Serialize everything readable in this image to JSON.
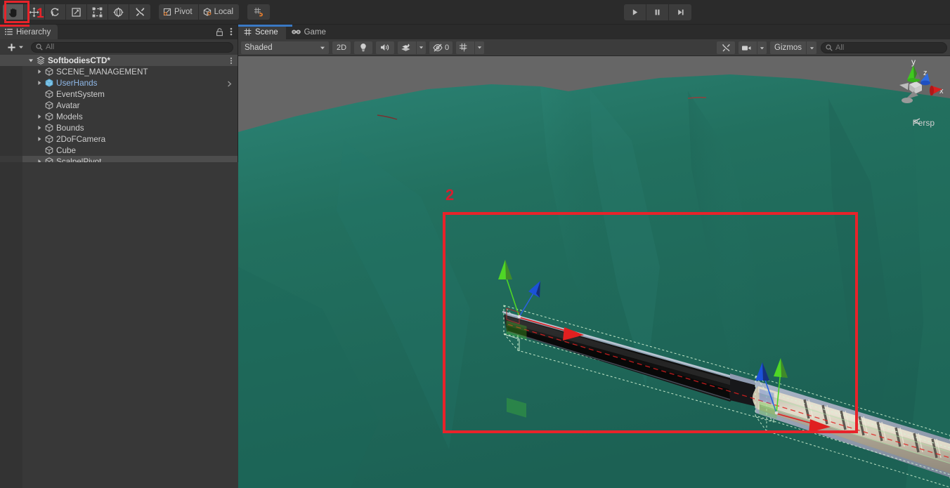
{
  "toolbar": {
    "tools": [
      {
        "name": "hand-tool",
        "label": "Hand Tool",
        "active": true
      },
      {
        "name": "move-tool",
        "label": "Move Tool",
        "active": false
      },
      {
        "name": "rotate-tool",
        "label": "Rotate Tool",
        "active": false
      },
      {
        "name": "scale-tool",
        "label": "Scale Tool",
        "active": false
      },
      {
        "name": "rect-tool",
        "label": "Rect Tool",
        "active": false
      },
      {
        "name": "transform-tool",
        "label": "Transform Tool",
        "active": false
      },
      {
        "name": "custom-tool",
        "label": "Custom Editor Tool",
        "active": false
      }
    ],
    "pivot_label": "Pivot",
    "handle_label": "Local",
    "snap_label": "Grid Snapping",
    "play_label": "Play",
    "pause_label": "Pause",
    "step_label": "Step"
  },
  "annotations": {
    "step1": "1",
    "step2": "2",
    "accent_color": "#e8232a"
  },
  "hierarchy": {
    "tab_label": "Hierarchy",
    "lock_label": "Lock",
    "menu_label": "Panel Menu",
    "add_label": "Create",
    "search_placeholder": "All",
    "scene_name": "SoftbodiesCTD*",
    "items": [
      {
        "label": "SCENE_MANAGEMENT",
        "indent": 1,
        "expandable": true,
        "prefab": false,
        "selected": false,
        "chevron": false
      },
      {
        "label": "UserHands",
        "indent": 1,
        "expandable": true,
        "prefab": true,
        "selected": false,
        "chevron": true
      },
      {
        "label": "EventSystem",
        "indent": 1,
        "expandable": false,
        "prefab": false,
        "selected": false,
        "chevron": false
      },
      {
        "label": "Avatar",
        "indent": 1,
        "expandable": false,
        "prefab": false,
        "selected": false,
        "chevron": false
      },
      {
        "label": "Models",
        "indent": 1,
        "expandable": true,
        "prefab": false,
        "selected": false,
        "chevron": false
      },
      {
        "label": "Bounds",
        "indent": 1,
        "expandable": true,
        "prefab": false,
        "selected": false,
        "chevron": false
      },
      {
        "label": "2DoFCamera",
        "indent": 1,
        "expandable": true,
        "prefab": false,
        "selected": false,
        "chevron": false
      },
      {
        "label": "Cube",
        "indent": 1,
        "expandable": false,
        "prefab": false,
        "selected": false,
        "chevron": false
      },
      {
        "label": "ScalpelPivot",
        "indent": 1,
        "expandable": true,
        "prefab": false,
        "selected": true,
        "chevron": false
      }
    ]
  },
  "scene_panel": {
    "tabs": [
      {
        "label": "Scene",
        "active": true,
        "icon": "grid-icon"
      },
      {
        "label": "Game",
        "active": false,
        "icon": "gamepad-icon"
      }
    ],
    "draw_mode": "Shaded",
    "two_d_label": "2D",
    "lighting_label": "Lighting",
    "audio_label": "Audio",
    "fx_label": "Effects",
    "hidden_count": "0",
    "grid_label": "Grid",
    "tools_label": "Scene Tools",
    "camera_label": "Scene Camera",
    "gizmos_label": "Gizmos",
    "gizmo_search_placeholder": "All",
    "axis_labels": {
      "x": "x",
      "y": "y",
      "z": "z"
    },
    "projection": "Persp"
  },
  "colors": {
    "drape_teal": "#1f6d60",
    "background_gray": "#666666",
    "gizmo_x": "#e02020",
    "gizmo_y": "#4fd626",
    "gizmo_z": "#1b52d8",
    "selection_outline": "#c8f5c8",
    "blade_dark": "#111111",
    "handle_beige": "#cfc6b0",
    "panel_bg": "#383838",
    "toolbar_bg": "#2b2b2b"
  }
}
